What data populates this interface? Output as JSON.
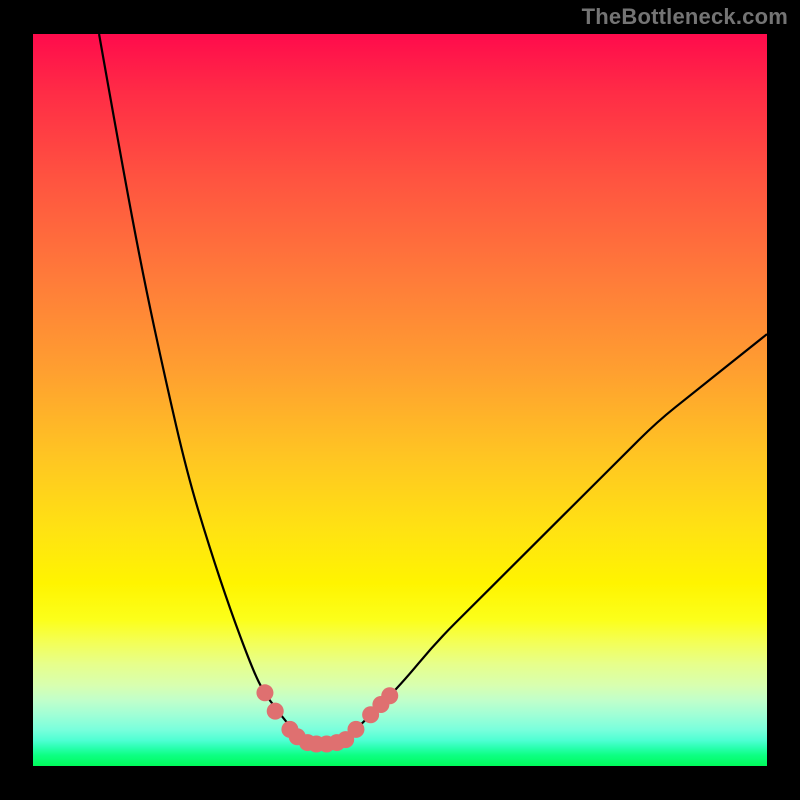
{
  "watermark": "TheBottleneck.com",
  "chart_data": {
    "type": "line",
    "title": "",
    "xlabel": "",
    "ylabel": "",
    "xlim": [
      0,
      100
    ],
    "ylim": [
      0,
      100
    ],
    "series": [
      {
        "name": "left-curve",
        "x": [
          9,
          12,
          15,
          18,
          21,
          24,
          27,
          30,
          31.5,
          33,
          34.5,
          36
        ],
        "y": [
          100,
          83,
          67,
          53,
          40,
          30,
          21,
          13,
          10,
          8,
          6,
          4.5
        ]
      },
      {
        "name": "right-curve",
        "x": [
          44,
          46,
          50,
          55,
          60,
          65,
          70,
          75,
          80,
          85,
          90,
          95,
          100
        ],
        "y": [
          5,
          7,
          11,
          17,
          22,
          27,
          32,
          37,
          42,
          47,
          51,
          55,
          59
        ]
      },
      {
        "name": "markers-left",
        "x": [
          31.6,
          33.0,
          35.0,
          36.0,
          37.4,
          38.6,
          40.0,
          41.4,
          42.6
        ],
        "y": [
          10.0,
          7.5,
          5.0,
          4.0,
          3.2,
          3.0,
          3.0,
          3.2,
          3.6
        ]
      },
      {
        "name": "markers-right",
        "x": [
          44.0,
          46.0,
          47.4,
          48.6
        ],
        "y": [
          5.0,
          7.0,
          8.4,
          9.6
        ]
      }
    ],
    "colors": {
      "curve": "#000000",
      "marker": "#df7070"
    }
  }
}
